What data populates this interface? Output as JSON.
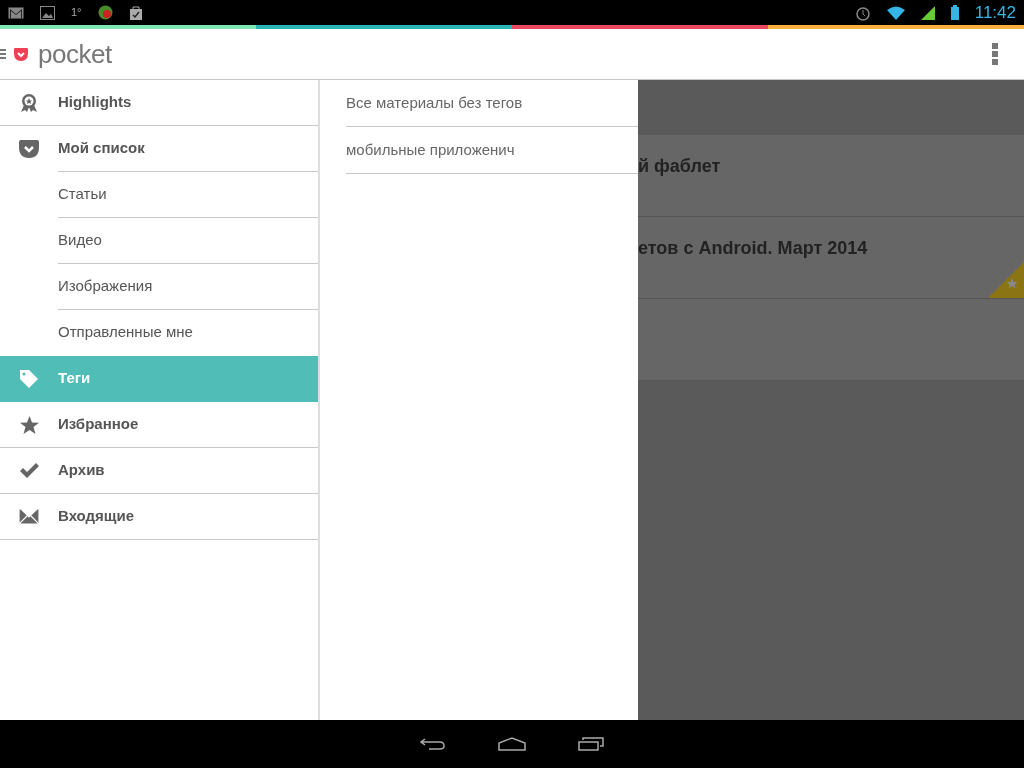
{
  "status_bar": {
    "temperature": "1°",
    "time": "11:42"
  },
  "app_bar": {
    "logo_text": "pocket"
  },
  "sidebar": {
    "items": [
      {
        "label": "Highlights",
        "kind": "primary",
        "selected": false
      },
      {
        "label": "Мой список",
        "kind": "primary",
        "selected": false
      },
      {
        "label": "Статьи",
        "kind": "sub",
        "selected": false
      },
      {
        "label": "Видео",
        "kind": "sub",
        "selected": false
      },
      {
        "label": "Изображения",
        "kind": "sub",
        "selected": false
      },
      {
        "label": "Отправленные мне",
        "kind": "sub",
        "selected": false
      },
      {
        "label": "Теги",
        "kind": "primary",
        "selected": true
      },
      {
        "label": "Избранное",
        "kind": "primary",
        "selected": false
      },
      {
        "label": "Архив",
        "kind": "primary",
        "selected": false
      },
      {
        "label": "Входящие",
        "kind": "primary",
        "selected": false
      }
    ]
  },
  "tags": [
    {
      "label": "Все материалы без тегов"
    },
    {
      "label": "мобильные приложенич"
    }
  ],
  "articles": [
    {
      "title": "й фаблет",
      "favorite": false
    },
    {
      "title": "етов с Android. Март 2014",
      "favorite": true
    },
    {
      "favorite": false
    }
  ]
}
